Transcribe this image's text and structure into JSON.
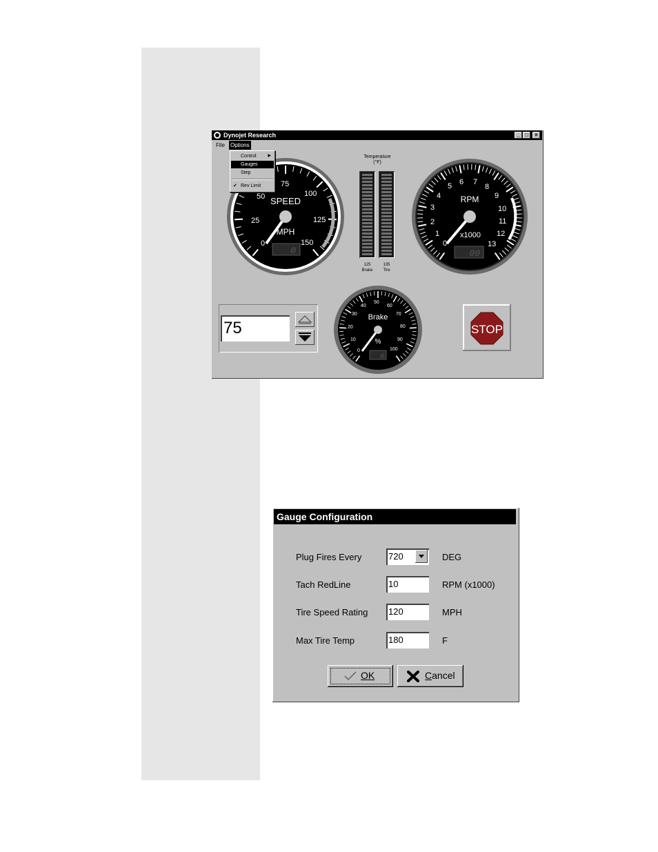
{
  "window": {
    "title": "Dynojet Research",
    "controls": [
      "_",
      "□",
      "×"
    ],
    "menu": [
      "File",
      "Options"
    ],
    "options_menu": {
      "items": [
        {
          "label": "Control",
          "submenu": true
        },
        {
          "label": "Gauges",
          "selected": true
        },
        {
          "label": "Step"
        },
        {
          "label": "Rev Limit",
          "checked": true
        }
      ],
      "check_mark": "✔",
      "submenu_arrow": "▶"
    },
    "speed_gauge": {
      "title": "SPEED",
      "unit": "MPH",
      "ticks": [
        "0",
        "25",
        "50",
        "75",
        "100",
        "125",
        "150"
      ],
      "digital": "0"
    },
    "rpm_gauge": {
      "title": "RPM",
      "unit": "x1000",
      "ticks": [
        "0",
        "1",
        "2",
        "3",
        "4",
        "5",
        "6",
        "7",
        "8",
        "9",
        "10",
        "11",
        "12",
        "13"
      ],
      "digital": "00"
    },
    "brake_gauge": {
      "title": "Brake",
      "unit": "%",
      "ticks": [
        "0",
        "10",
        "20",
        "30",
        "40",
        "50",
        "60",
        "70",
        "80",
        "90",
        "100"
      ],
      "digital": "0"
    },
    "temperature": {
      "title_line1": "Temperature",
      "title_line2": "(°F)",
      "brake_value": "125",
      "brake_label": "Brake",
      "tire_value": "135",
      "tire_label": "Tire"
    },
    "stepper": {
      "value": "75"
    },
    "stop_label": "STOP",
    "colors": {
      "stop_red": "#8a1a1a",
      "gauge_face": "#000000",
      "panel": "#c0c0c0"
    }
  },
  "dialog": {
    "title": "Gauge Configuration",
    "fields": [
      {
        "label": "Plug Fires Every",
        "value": "720",
        "unit": "DEG",
        "type": "select"
      },
      {
        "label": "Tach RedLine",
        "value": "10",
        "unit": "RPM (x1000)",
        "type": "text"
      },
      {
        "label": "Tire Speed Rating",
        "value": "120",
        "unit": "MPH",
        "type": "text"
      },
      {
        "label": "Max Tire Temp",
        "value": "180",
        "unit": "F",
        "type": "text"
      }
    ],
    "ok_label": "OK",
    "cancel_label": "Cancel"
  }
}
